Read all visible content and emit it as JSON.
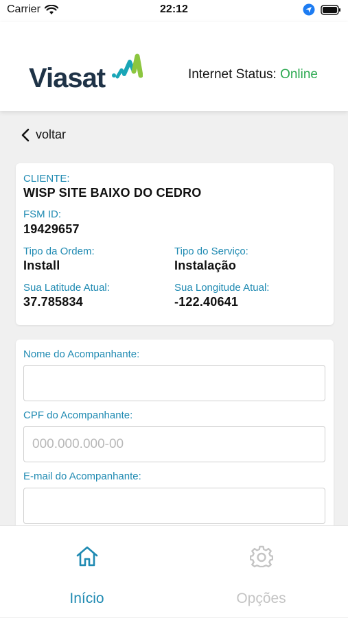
{
  "status_bar": {
    "carrier": "Carrier",
    "time": "22:12"
  },
  "header": {
    "logo_text": "Viasat",
    "internet_status_label": "Internet Status:",
    "internet_status_value": "Online"
  },
  "nav": {
    "back_label": "voltar"
  },
  "info": {
    "cliente_label": "CLIENTE:",
    "cliente_value": "WISP SITE BAIXO DO CEDRO",
    "fsm_label": "FSM ID:",
    "fsm_value": "19429657",
    "tipo_ordem_label": "Tipo da Ordem:",
    "tipo_ordem_value": "Install",
    "tipo_servico_label": "Tipo do Serviço:",
    "tipo_servico_value": "Instalação",
    "latitude_label": "Sua Latitude Atual:",
    "latitude_value": "37.785834",
    "longitude_label": "Sua Longitude Atual:",
    "longitude_value": "-122.40641"
  },
  "form": {
    "nome_label": "Nome do Acompanhante:",
    "nome_value": "",
    "cpf_label": "CPF do Acompanhante:",
    "cpf_placeholder": "000.000.000-00",
    "email_label": "E-mail do Acompanhante:",
    "email_value": ""
  },
  "tabs": [
    {
      "label": "Início",
      "icon": "home-icon",
      "active": true
    },
    {
      "label": "Opções",
      "icon": "gear-icon",
      "active": false
    }
  ],
  "colors": {
    "accent": "#1f8ab2",
    "online": "#2aa84f",
    "logo_dark": "#1f3347",
    "logo_green": "#8cc63f",
    "logo_teal": "#1aa6b7",
    "inactive": "#c4c4c4"
  }
}
